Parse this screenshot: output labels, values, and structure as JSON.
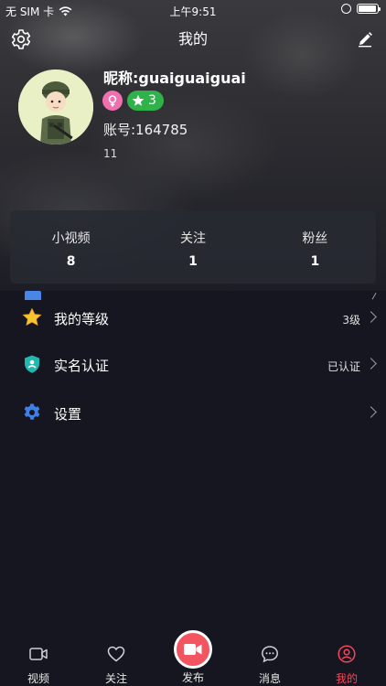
{
  "status_bar": {
    "carrier": "无 SIM 卡",
    "time": "上午9:51",
    "battery_level": 0.85
  },
  "nav": {
    "title": "我的"
  },
  "profile": {
    "nickname": "昵称:guaiguaiguai",
    "level_badge": "3",
    "account": "账号:164785",
    "signature": "11"
  },
  "stats": [
    {
      "label": "小视频",
      "value": "8"
    },
    {
      "label": "关注",
      "value": "1"
    },
    {
      "label": "粉丝",
      "value": "1"
    }
  ],
  "menu": [
    {
      "label": "我的等级",
      "value": "3级",
      "icon": "star-icon"
    },
    {
      "label": "实名认证",
      "value": "已认证",
      "icon": "shield-icon"
    },
    {
      "label": "设置",
      "value": "",
      "icon": "gear-icon"
    }
  ],
  "tabs": [
    {
      "label": "视频",
      "icon": "video-icon"
    },
    {
      "label": "关注",
      "icon": "heart-icon"
    },
    {
      "label": "发布",
      "icon": "camera-icon"
    },
    {
      "label": "消息",
      "icon": "chat-icon"
    },
    {
      "label": "我的",
      "icon": "user-icon",
      "active": true
    }
  ],
  "colors": {
    "accent": "#f3475c",
    "background": "#15161f",
    "level_badge": "#2fb24a",
    "gender_badge": "#f06fae"
  }
}
